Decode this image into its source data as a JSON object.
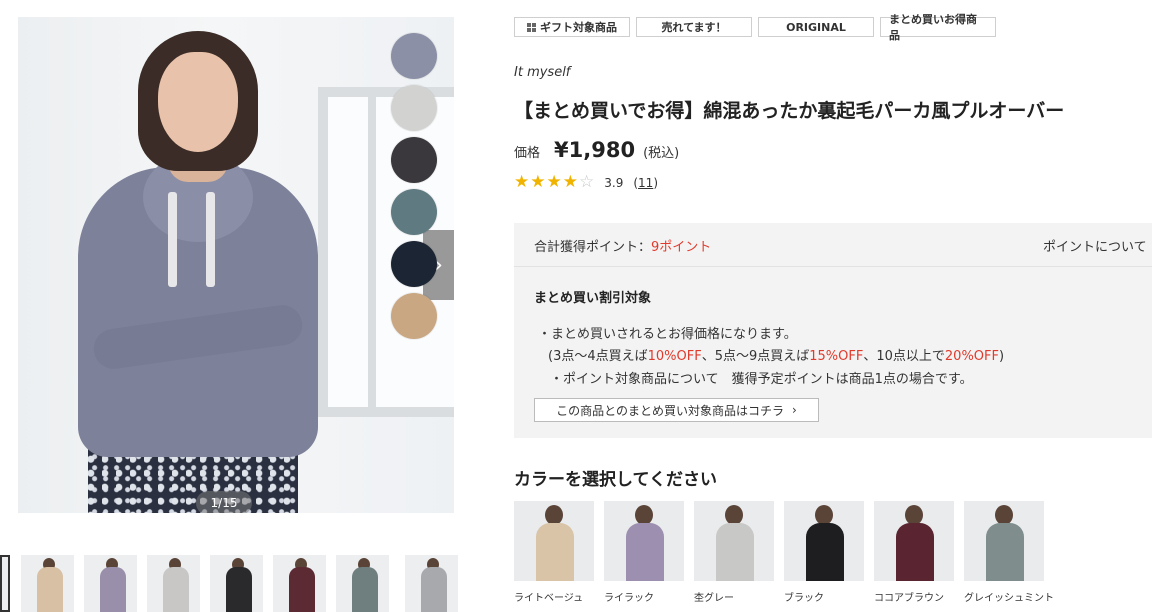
{
  "gallery": {
    "counter": "1/15",
    "next_arrow": "›",
    "swatch_colors": [
      "#8b90a6",
      "#d2d3d0",
      "#3a383c",
      "#5f7a80",
      "#1c2533",
      "#c9a783"
    ],
    "thumbnail_colors": [
      "#333333",
      "#d8c0a4",
      "#9a8fab",
      "#c9c7c5",
      "#2a2a2c",
      "#5b2a33",
      "#6f7f80",
      "#a7a9ad"
    ]
  },
  "badges": [
    {
      "label": "ギフト対象商品",
      "icon": "gift-grid-icon"
    },
    {
      "label": "売れてます！"
    },
    {
      "label": "ORIGINAL"
    },
    {
      "label": "まとめ買いお得商品"
    }
  ],
  "product": {
    "brand": "It myself",
    "title": "【まとめ買いでお得】綿混あったか裏起毛パーカ風プルオーバー",
    "price_label": "価格",
    "price": "¥1,980",
    "tax": "(税込)",
    "rating": "3.9",
    "rating_stars": 4,
    "review_count": "11",
    "review_open": "(",
    "review_close": ")"
  },
  "points": {
    "label": "合計獲得ポイント：",
    "value": "9ポイント",
    "about": "ポイントについて"
  },
  "bundle": {
    "title": "まとめ買い割引対象",
    "line1": "・まとめ買いされるとお得価格になります。",
    "line2_parts": [
      "(3点〜4点買えば",
      "10%OFF",
      "、5点〜9点買えば",
      "15%OFF",
      "、10点以上で",
      "20%OFF",
      ")"
    ],
    "line3": "・ポイント対象商品について　獲得予定ポイントは商品1点の場合です。",
    "button": "この商品とのまとめ買い対象商品はコチラ",
    "button_arrow": "›"
  },
  "colors": {
    "heading": "カラーを選択してください",
    "items": [
      {
        "name": "ライトベージュ",
        "color": "#d9c4a8"
      },
      {
        "name": "ライラック",
        "color": "#9c8fb0"
      },
      {
        "name": "杢グレー",
        "color": "#c8c8c6"
      },
      {
        "name": "ブラック",
        "color": "#1e1e20"
      },
      {
        "name": "ココアブラウン",
        "color": "#5a2430"
      },
      {
        "name": "グレイッシュミント",
        "color": "#7f8e8c"
      }
    ]
  }
}
